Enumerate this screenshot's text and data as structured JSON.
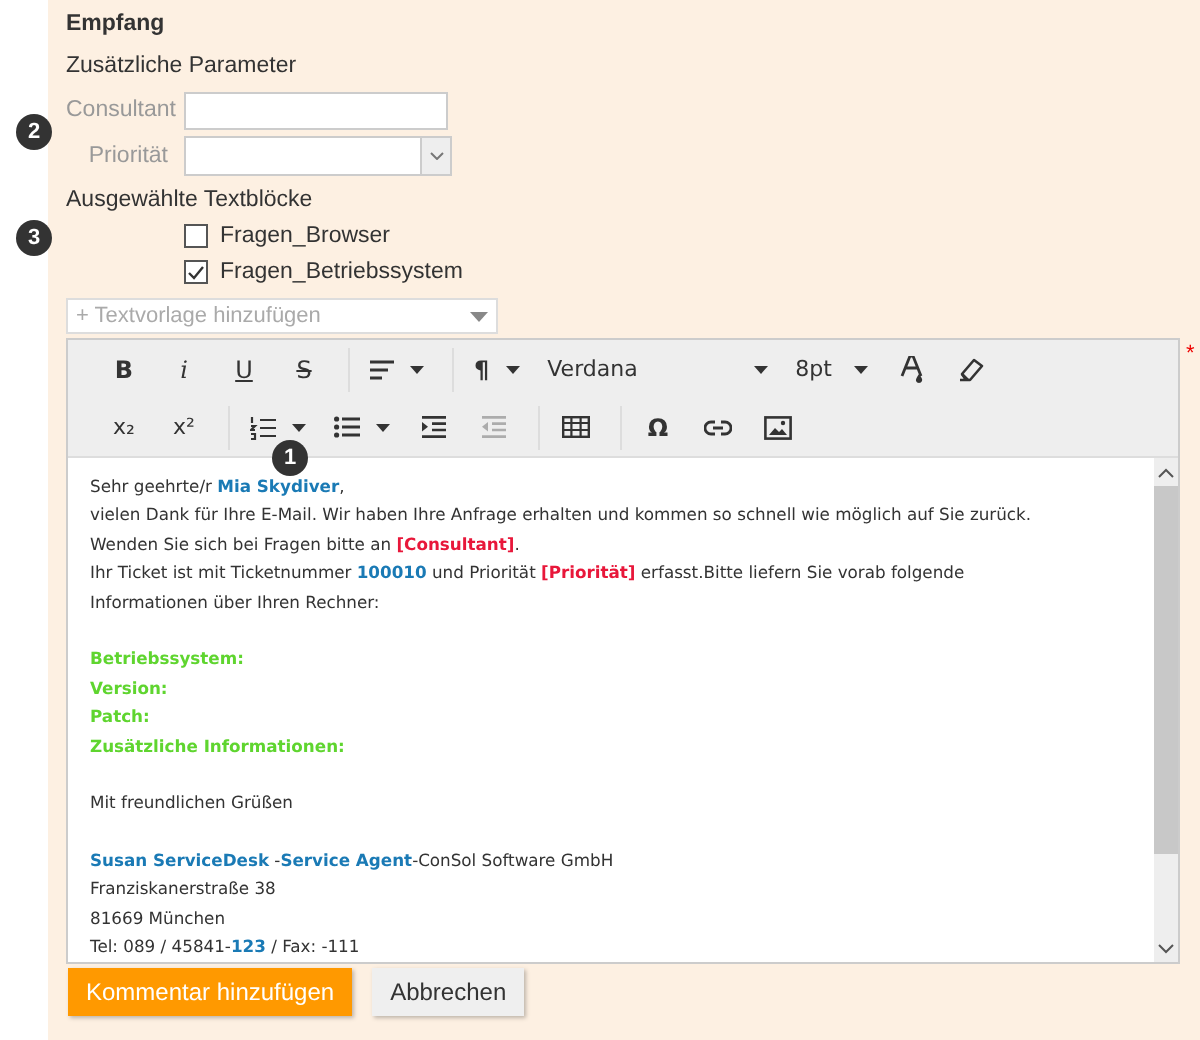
{
  "section_title": "Empfang",
  "params": {
    "title": "Zusätzliche Parameter",
    "badge": "2",
    "fields": [
      {
        "label": "Consultant",
        "kind": "text"
      },
      {
        "label": "Priorität",
        "kind": "select"
      }
    ]
  },
  "textblocks": {
    "title": "Ausgewählte Textblöcke",
    "badge": "3",
    "items": [
      {
        "label": "Fragen_Browser",
        "checked": false
      },
      {
        "label": "Fragen_Betriebssystem",
        "checked": true
      }
    ]
  },
  "template_select": {
    "placeholder": "+ Textvorlage hinzufügen"
  },
  "required_mark": "*",
  "toolbar": {
    "badge": "1",
    "rows": [
      [
        [
          {
            "kind": "bold",
            "label": "B",
            "disabled": false
          },
          {
            "kind": "italic",
            "label": "i",
            "disabled": false
          },
          {
            "kind": "underline",
            "label": "U",
            "disabled": false
          },
          {
            "kind": "strike",
            "label": "S",
            "disabled": false
          }
        ],
        [
          {
            "kind": "align",
            "disabled": false
          }
        ],
        [
          {
            "kind": "paragraph",
            "label": "¶",
            "disabled": false
          },
          {
            "kind": "font-select",
            "label": "Verdana",
            "disabled": false
          },
          {
            "kind": "size-select",
            "label": "8pt",
            "disabled": false
          },
          {
            "kind": "color",
            "disabled": false
          },
          {
            "kind": "eraser",
            "disabled": false
          }
        ]
      ],
      [
        [
          {
            "kind": "subscript",
            "label": "x₂",
            "disabled": false
          },
          {
            "kind": "superscript",
            "label": "x²",
            "disabled": false
          }
        ],
        [
          {
            "kind": "ordered-list",
            "disabled": false
          },
          {
            "kind": "bullet-list",
            "disabled": false
          },
          {
            "kind": "indent",
            "disabled": false
          },
          {
            "kind": "outdent",
            "disabled": true
          }
        ],
        [
          {
            "kind": "table",
            "disabled": false
          }
        ],
        [
          {
            "kind": "special-char",
            "label": "Ω",
            "disabled": false
          },
          {
            "kind": "link",
            "disabled": false
          },
          {
            "kind": "image",
            "disabled": false
          }
        ]
      ]
    ]
  },
  "editor": {
    "lines": [
      {
        "kind": "text",
        "segments": [
          {
            "text": "Sehr geehrte/r ",
            "kind": "plain"
          },
          {
            "text": "Mia Skydiver",
            "kind": "field"
          },
          {
            "text": ",",
            "kind": "plain"
          }
        ]
      },
      {
        "kind": "text",
        "segments": [
          {
            "text": "vielen Dank für Ihre E-Mail. Wir haben Ihre Anfrage erhalten und kommen so schnell wie möglich auf Sie zurück.",
            "kind": "plain"
          }
        ]
      },
      {
        "kind": "text",
        "segments": [
          {
            "text": "Wenden Sie sich bei Fragen bitte an ",
            "kind": "plain"
          },
          {
            "text": "[Consultant]",
            "kind": "placeholder"
          },
          {
            "text": ".",
            "kind": "plain"
          }
        ]
      },
      {
        "kind": "text",
        "segments": [
          {
            "text": "Ihr Ticket ist mit Ticketnummer ",
            "kind": "plain"
          },
          {
            "text": "100010",
            "kind": "field"
          },
          {
            "text": " und Priorität ",
            "kind": "plain"
          },
          {
            "text": "[Priorität]",
            "kind": "placeholder"
          },
          {
            "text": " erfasst.Bitte liefern Sie vorab folgende",
            "kind": "plain"
          }
        ]
      },
      {
        "kind": "text",
        "segments": [
          {
            "text": "Informationen über Ihren Rechner:",
            "kind": "plain"
          }
        ]
      },
      {
        "kind": "blank"
      },
      {
        "kind": "text",
        "segments": [
          {
            "text": "Betriebssystem:",
            "kind": "heading"
          }
        ]
      },
      {
        "kind": "text",
        "segments": [
          {
            "text": "Version:",
            "kind": "heading"
          }
        ]
      },
      {
        "kind": "text",
        "segments": [
          {
            "text": "Patch:",
            "kind": "heading"
          }
        ]
      },
      {
        "kind": "text",
        "segments": [
          {
            "text": "Zusätzliche Informationen:",
            "kind": "heading"
          }
        ]
      },
      {
        "kind": "blank"
      },
      {
        "kind": "text",
        "segments": [
          {
            "text": "Mit freundlichen Grüßen",
            "kind": "plain"
          }
        ]
      },
      {
        "kind": "blank"
      },
      {
        "kind": "text",
        "segments": [
          {
            "text": "Susan ServiceDesk",
            "kind": "field"
          },
          {
            "text": " -",
            "kind": "plain"
          },
          {
            "text": "Service Agent",
            "kind": "field"
          },
          {
            "text": "-ConSol Software GmbH",
            "kind": "plain"
          }
        ]
      },
      {
        "kind": "text",
        "segments": [
          {
            "text": "Franziskanerstraße 38",
            "kind": "plain"
          }
        ]
      },
      {
        "kind": "text",
        "segments": [
          {
            "text": "81669 München",
            "kind": "plain"
          }
        ]
      },
      {
        "kind": "text",
        "segments": [
          {
            "text": "Tel: 089 / 45841-",
            "kind": "plain"
          },
          {
            "text": "123",
            "kind": "field"
          },
          {
            "text": " / Fax: -111",
            "kind": "plain"
          }
        ]
      }
    ]
  },
  "buttons": [
    {
      "label": "Kommentar hinzufügen",
      "kind": "primary"
    },
    {
      "label": "Abbrechen",
      "kind": "secondary"
    }
  ]
}
